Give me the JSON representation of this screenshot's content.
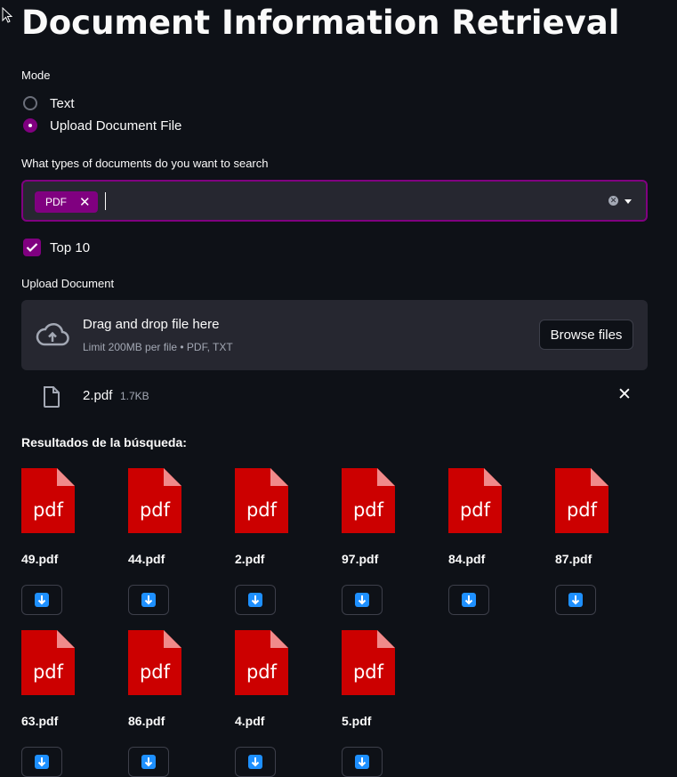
{
  "page": {
    "title": "Document Information Retrieval"
  },
  "mode": {
    "label": "Mode",
    "options": [
      "Text",
      "Upload Document File"
    ],
    "selected": "Upload Document File"
  },
  "doc_types": {
    "label": "What types of documents do you want to search",
    "selected_chips": [
      "PDF"
    ],
    "accent_color": "#800080"
  },
  "top10": {
    "label": "Top 10",
    "checked": true
  },
  "upload": {
    "label": "Upload Document",
    "drop_title": "Drag and drop file here",
    "drop_limit": "Limit 200MB per file • PDF, TXT",
    "browse_label": "Browse files",
    "file": {
      "name": "2.pdf",
      "size": "1.7KB"
    }
  },
  "results": {
    "title": "Resultados de la búsqueda:",
    "icon_label": "pdf",
    "items": [
      "49.pdf",
      "44.pdf",
      "2.pdf",
      "97.pdf",
      "84.pdf",
      "87.pdf",
      "63.pdf",
      "86.pdf",
      "4.pdf",
      "5.pdf"
    ]
  },
  "icons": {
    "cursor": "mouse-pointer-icon",
    "cloud": "cloud-upload-icon",
    "file": "file-icon",
    "remove": "close-icon",
    "download": "download-arrow-icon",
    "pdf": "pdf-file-icon"
  },
  "colors": {
    "background": "#0e1117",
    "surface": "#262730",
    "accent": "#800080",
    "pdf_red": "#cc0000",
    "download_blue": "#1e90ff"
  }
}
